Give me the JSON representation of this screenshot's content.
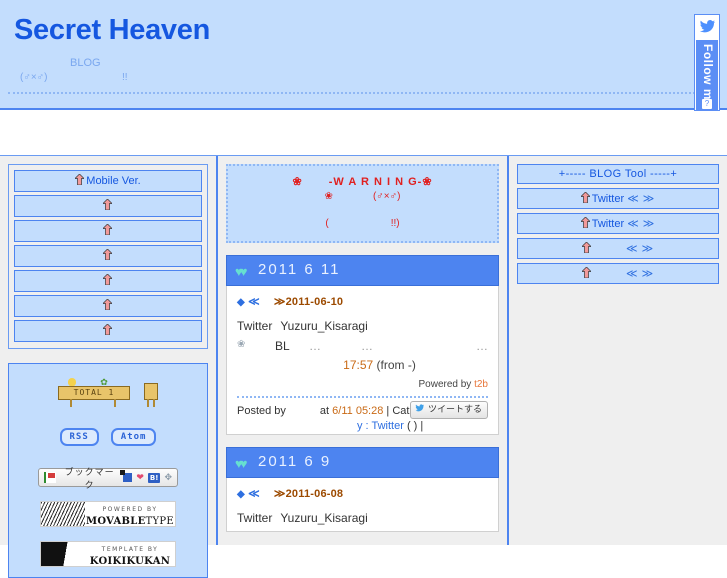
{
  "header": {
    "site_title": "Secret Heaven",
    "sub_blog": "BLOG",
    "sub_gender": "(♂×♂)",
    "sub_bang": "!!",
    "follow_me": "Follow me",
    "follow_help": "?",
    "bird_icon": "twitter-bird-icon"
  },
  "left_sidebar": {
    "nav_items": [
      {
        "label": "Mobile Ver.",
        "has_arrow": true
      },
      {
        "label": "",
        "has_arrow": true
      },
      {
        "label": "",
        "has_arrow": true
      },
      {
        "label": "",
        "has_arrow": true
      },
      {
        "label": "",
        "has_arrow": true
      },
      {
        "label": "",
        "has_arrow": true
      },
      {
        "label": "",
        "has_arrow": true
      }
    ],
    "counter": {
      "label": "TOTAL",
      "value": "1"
    },
    "feeds": [
      {
        "label": "RSS"
      },
      {
        "label": "Atom"
      }
    ],
    "bookmark_bar": {
      "text": "ブックマーク",
      "hatena_label": "B!"
    },
    "badges": [
      {
        "small": "POWERED BY",
        "big_bold": "MOVABLE",
        "big_thin": "TYPE"
      },
      {
        "small": "TEMPLATE BY",
        "big_bold": "KOIKIKUKAN",
        "big_thin": ""
      }
    ]
  },
  "center": {
    "warning": {
      "line1_left": "❀",
      "line1_text": "-W A R N I N G-",
      "line1_right": "❀",
      "line2_left": "❀",
      "line2_text": "(♂×♂)",
      "line3_left": "(",
      "line3_right": "!!)"
    },
    "entries": [
      {
        "date_header": "2011  6  11",
        "title_diamond": "◆",
        "title_prev": "≪",
        "title_next": "≫",
        "title_date": "2011-06-10",
        "tw_service": "Twitter",
        "tw_user": "Yuzuru_Kisaragi",
        "tw_paw": "❀",
        "tw_tag": "BL",
        "tw_dots1": "…",
        "tw_dots2": "…",
        "tw_dots3": "…",
        "tw_time": "17:57",
        "tw_from": "(from -)",
        "powered_text": "Powered by",
        "powered_link": "t2b",
        "footer_posted": "Posted by",
        "footer_at": "at",
        "footer_date": "6/11 05:28",
        "footer_category": "| Categor",
        "footer_line2_a": "y : Twitter",
        "footer_line2_b": "(  ) |",
        "tweet_button": "ツイートする"
      },
      {
        "date_header": "2011  6  9",
        "title_diamond": "◆",
        "title_prev": "≪",
        "title_next": "≫",
        "title_date": "2011-06-08",
        "tw_service": "Twitter",
        "tw_user": "Yuzuru_Kisaragi"
      }
    ]
  },
  "right_sidebar": {
    "panel_header": "+----- BLOG Tool -----+",
    "items": [
      {
        "label": "Twitter",
        "has_arrow": true,
        "prev": "≪",
        "next": "≫"
      },
      {
        "label": "Twitter",
        "has_arrow": true,
        "prev": "≪",
        "next": "≫"
      },
      {
        "label": "",
        "has_arrow": true,
        "prev": "≪",
        "next": "≫"
      },
      {
        "label": "",
        "has_arrow": true,
        "prev": "≪",
        "next": "≫"
      }
    ]
  },
  "colors": {
    "header_bg": "#c3ddfd",
    "accent_blue": "#4d84f0",
    "title_blue": "#1557e0",
    "column_bg": "#efefef",
    "warning_red": "#e02020",
    "entry_title_brown": "#9c4a00",
    "t2b_orange": "#e8763a"
  }
}
